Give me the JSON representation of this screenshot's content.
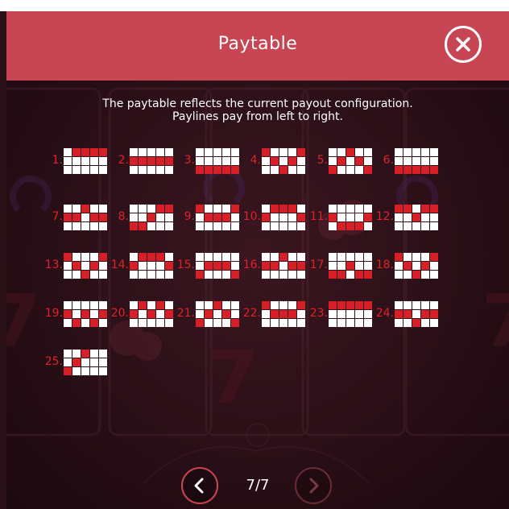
{
  "header": {
    "title": "Paytable",
    "close_icon": "close-icon"
  },
  "intro": {
    "line1": "The paytable reflects the current payout configuration.",
    "line2": "Paylines pay from left to right."
  },
  "paylines": [
    {
      "label": "1.",
      "rows": [
        [
          0,
          1,
          1,
          1,
          1
        ],
        [
          0,
          0,
          0,
          0,
          0
        ],
        [
          0,
          0,
          0,
          0,
          0
        ]
      ]
    },
    {
      "label": "2.",
      "rows": [
        [
          0,
          0,
          0,
          0,
          0
        ],
        [
          1,
          1,
          1,
          1,
          1
        ],
        [
          0,
          0,
          0,
          0,
          0
        ]
      ]
    },
    {
      "label": "3.",
      "rows": [
        [
          0,
          0,
          0,
          0,
          0
        ],
        [
          0,
          0,
          0,
          0,
          0
        ],
        [
          1,
          1,
          1,
          1,
          1
        ]
      ]
    },
    {
      "label": "4.",
      "rows": [
        [
          1,
          0,
          0,
          0,
          1
        ],
        [
          0,
          1,
          0,
          1,
          0
        ],
        [
          0,
          0,
          1,
          0,
          0
        ]
      ]
    },
    {
      "label": "5.",
      "rows": [
        [
          0,
          0,
          1,
          0,
          0
        ],
        [
          0,
          1,
          0,
          1,
          0
        ],
        [
          1,
          0,
          0,
          0,
          1
        ]
      ]
    },
    {
      "label": "6.",
      "rows": [
        [
          0,
          0,
          0,
          0,
          0
        ],
        [
          0,
          0,
          0,
          0,
          0
        ],
        [
          1,
          1,
          1,
          1,
          1
        ]
      ]
    },
    {
      "label": "7.",
      "rows": [
        [
          0,
          0,
          1,
          0,
          0
        ],
        [
          1,
          1,
          0,
          1,
          1
        ],
        [
          0,
          0,
          0,
          0,
          0
        ]
      ]
    },
    {
      "label": "8.",
      "rows": [
        [
          0,
          0,
          0,
          1,
          1
        ],
        [
          0,
          0,
          1,
          0,
          0
        ],
        [
          1,
          1,
          0,
          0,
          0
        ]
      ]
    },
    {
      "label": "9.",
      "rows": [
        [
          1,
          0,
          0,
          0,
          1
        ],
        [
          0,
          1,
          1,
          1,
          0
        ],
        [
          0,
          0,
          0,
          0,
          0
        ]
      ]
    },
    {
      "label": "10.",
      "rows": [
        [
          0,
          1,
          1,
          1,
          0
        ],
        [
          1,
          0,
          0,
          0,
          1
        ],
        [
          0,
          0,
          0,
          0,
          0
        ]
      ]
    },
    {
      "label": "11.",
      "rows": [
        [
          0,
          0,
          0,
          0,
          0
        ],
        [
          1,
          0,
          0,
          0,
          1
        ],
        [
          0,
          1,
          1,
          1,
          0
        ]
      ]
    },
    {
      "label": "12.",
      "rows": [
        [
          1,
          1,
          0,
          1,
          1
        ],
        [
          0,
          0,
          1,
          0,
          0
        ],
        [
          0,
          0,
          0,
          0,
          0
        ]
      ]
    },
    {
      "label": "13.",
      "rows": [
        [
          1,
          0,
          0,
          0,
          1
        ],
        [
          0,
          1,
          0,
          1,
          0
        ],
        [
          0,
          0,
          1,
          0,
          0
        ]
      ]
    },
    {
      "label": "14.",
      "rows": [
        [
          0,
          1,
          1,
          1,
          0
        ],
        [
          1,
          0,
          0,
          0,
          1
        ],
        [
          0,
          0,
          0,
          0,
          0
        ]
      ]
    },
    {
      "label": "15.",
      "rows": [
        [
          0,
          0,
          0,
          0,
          0
        ],
        [
          0,
          1,
          1,
          1,
          0
        ],
        [
          1,
          0,
          0,
          0,
          1
        ]
      ]
    },
    {
      "label": "16.",
      "rows": [
        [
          0,
          0,
          1,
          0,
          0
        ],
        [
          1,
          1,
          0,
          1,
          1
        ],
        [
          0,
          0,
          0,
          0,
          0
        ]
      ]
    },
    {
      "label": "17.",
      "rows": [
        [
          0,
          0,
          0,
          0,
          0
        ],
        [
          0,
          0,
          1,
          0,
          0
        ],
        [
          1,
          1,
          0,
          1,
          1
        ]
      ]
    },
    {
      "label": "18.",
      "rows": [
        [
          1,
          0,
          0,
          0,
          1
        ],
        [
          0,
          1,
          0,
          1,
          0
        ],
        [
          0,
          0,
          1,
          0,
          0
        ]
      ]
    },
    {
      "label": "19.",
      "rows": [
        [
          0,
          0,
          0,
          0,
          0
        ],
        [
          1,
          0,
          1,
          0,
          1
        ],
        [
          0,
          1,
          0,
          1,
          0
        ]
      ]
    },
    {
      "label": "20.",
      "rows": [
        [
          0,
          1,
          0,
          1,
          0
        ],
        [
          1,
          0,
          1,
          0,
          1
        ],
        [
          0,
          0,
          0,
          0,
          0
        ]
      ]
    },
    {
      "label": "21.",
      "rows": [
        [
          0,
          0,
          1,
          0,
          0
        ],
        [
          0,
          1,
          0,
          1,
          0
        ],
        [
          1,
          0,
          0,
          0,
          1
        ]
      ]
    },
    {
      "label": "22.",
      "rows": [
        [
          1,
          0,
          0,
          0,
          1
        ],
        [
          0,
          1,
          1,
          1,
          0
        ],
        [
          0,
          0,
          0,
          0,
          0
        ]
      ]
    },
    {
      "label": "23.",
      "rows": [
        [
          1,
          1,
          1,
          1,
          1
        ],
        [
          0,
          0,
          0,
          0,
          0
        ],
        [
          0,
          0,
          0,
          0,
          0
        ]
      ]
    },
    {
      "label": "24.",
      "rows": [
        [
          0,
          0,
          0,
          0,
          0
        ],
        [
          1,
          1,
          0,
          1,
          1
        ],
        [
          0,
          0,
          1,
          0,
          0
        ]
      ]
    },
    {
      "label": "25.",
      "rows": [
        [
          0,
          0,
          1,
          0,
          0
        ],
        [
          0,
          1,
          0,
          0,
          0
        ],
        [
          1,
          0,
          0,
          0,
          0
        ]
      ]
    }
  ],
  "pagination": {
    "current": "7/7",
    "prev_icon": "chevron-left-icon",
    "next_icon": "chevron-right-icon"
  },
  "colors": {
    "header_bg": "#c84654",
    "active_cell": "#d61f26",
    "inactive_cell": "#ffffff",
    "number": "#e0222a"
  }
}
